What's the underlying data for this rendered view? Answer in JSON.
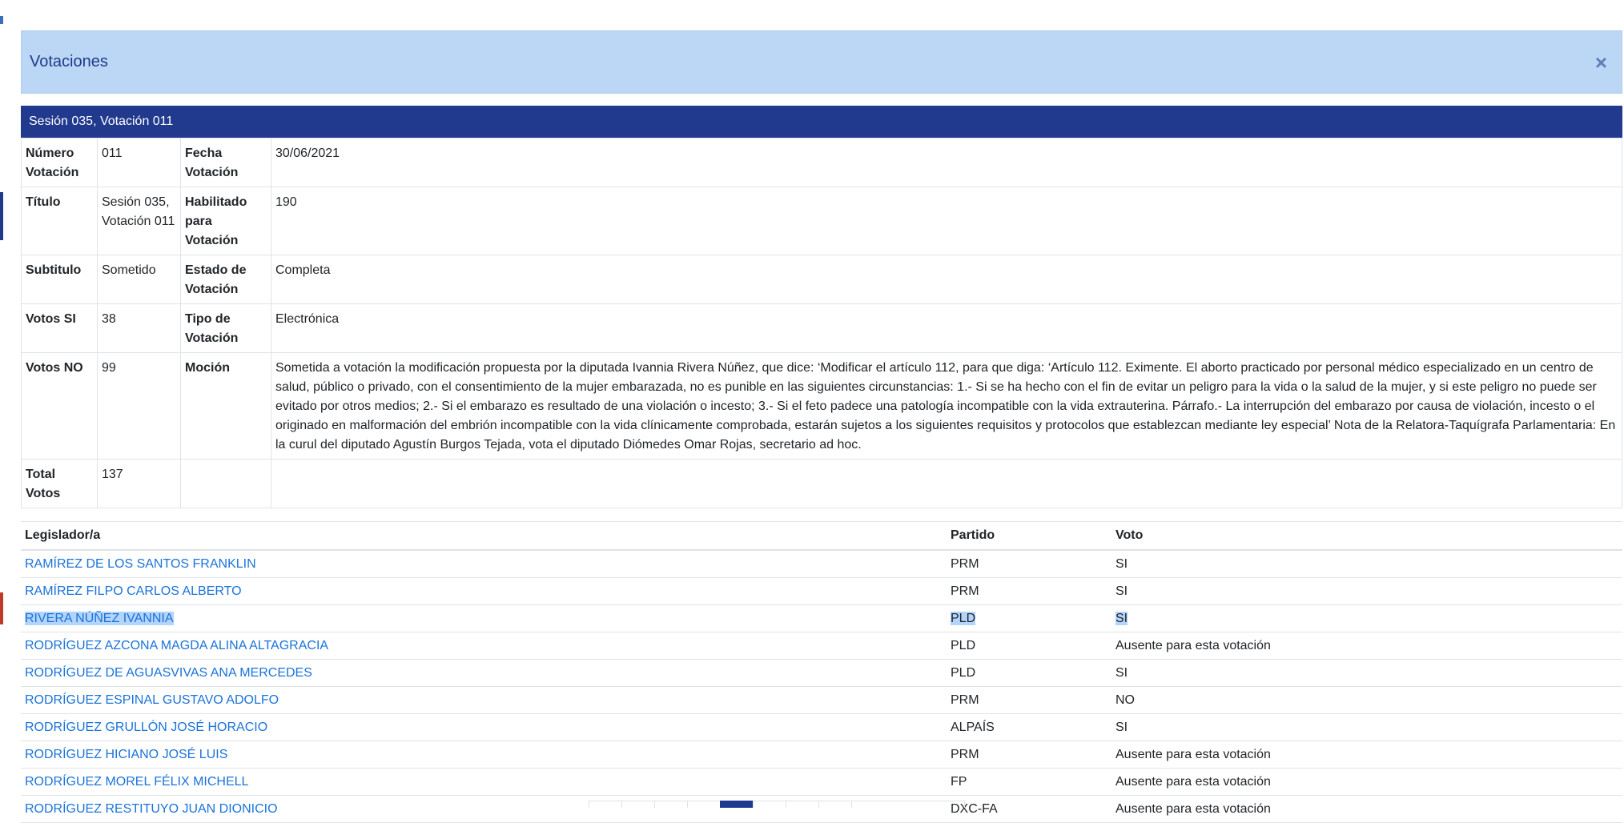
{
  "modal": {
    "title": "Votaciones",
    "close_icon": "×"
  },
  "session_header": "Sesión 035, Votación 011",
  "details": {
    "numero_label": "Número Votación",
    "numero": "011",
    "fecha_label": "Fecha Votación",
    "fecha": "30/06/2021",
    "titulo_label": "Título",
    "titulo": "Sesión 035, Votación 011",
    "habilitado_label": "Habilitado para Votación",
    "habilitado": "190",
    "subtitulo_label": "Subtitulo",
    "subtitulo": "Sometido",
    "estado_label": "Estado de Votación",
    "estado": "Completa",
    "votos_si_label": "Votos SI",
    "votos_si": "38",
    "tipo_label": "Tipo de Votación",
    "tipo": "Electrónica",
    "votos_no_label": "Votos NO",
    "votos_no": "99",
    "mocion_label": "Moción",
    "mocion": "Sometida a votación la modificación propuesta por la diputada Ivannia Rivera Núñez, que dice: ‘Modificar el artículo 112, para que diga: ‘Artículo 112. Eximente. El aborto practicado por personal médico especializado en un centro de salud, público o privado, con el consentimiento de la mujer embarazada, no es punible en las siguientes circunstancias: 1.- Si se ha hecho con el fin de evitar un peligro para la vida o la salud de la mujer, y si este peligro no puede ser evitado por otros medios; 2.- Si el embarazo es resultado de una violación o incesto; 3.- Si el feto padece una patología incompatible con la vida extrauterina. Párrafo.- La interrupción del embarazo por causa de violación, incesto o el originado en malformación del embrión incompatible con la vida clínicamente comprobada, estarán sujetos a los siguientes requisitos y protocolos que establezcan mediante ley especial’ Nota de la Relatora-Taquígrafa Parlamentaria: En la curul del diputado Agustín Burgos Tejada, vota el diputado Diómedes Omar Rojas, secretario ad hoc.",
    "total_label": "Total Votos",
    "total": "137"
  },
  "votes_table": {
    "headers": {
      "legislador": "Legislador/a",
      "partido": "Partido",
      "voto": "Voto"
    },
    "rows": [
      {
        "name": "RAMÍREZ DE LOS SANTOS FRANKLIN",
        "party": "PRM",
        "vote": "SI"
      },
      {
        "name": "RAMÍREZ FILPO CARLOS ALBERTO",
        "party": "PRM",
        "vote": "SI"
      },
      {
        "name": "RIVERA NÚÑEZ IVANNIA",
        "party": "PLD",
        "vote": "SI"
      },
      {
        "name": "RODRÍGUEZ AZCONA MAGDA ALINA ALTAGRACIA",
        "party": "PLD",
        "vote": "Ausente para esta votación"
      },
      {
        "name": "RODRÍGUEZ DE AGUASVIVAS ANA MERCEDES",
        "party": "PLD",
        "vote": "SI"
      },
      {
        "name": "RODRÍGUEZ ESPINAL GUSTAVO ADOLFO",
        "party": "PRM",
        "vote": "NO"
      },
      {
        "name": "RODRÍGUEZ GRULLÓN JOSÉ HORACIO",
        "party": "ALPAÍS",
        "vote": "SI"
      },
      {
        "name": "RODRÍGUEZ HICIANO JOSÉ LUIS",
        "party": "PRM",
        "vote": "Ausente para esta votación"
      },
      {
        "name": "RODRÍGUEZ MOREL FÉLIX MICHELL",
        "party": "FP",
        "vote": "Ausente para esta votación"
      },
      {
        "name": "RODRÍGUEZ RESTITUYO JUAN DIONICIO",
        "party": "DXC-FA",
        "vote": "Ausente para esta votación"
      }
    ]
  }
}
